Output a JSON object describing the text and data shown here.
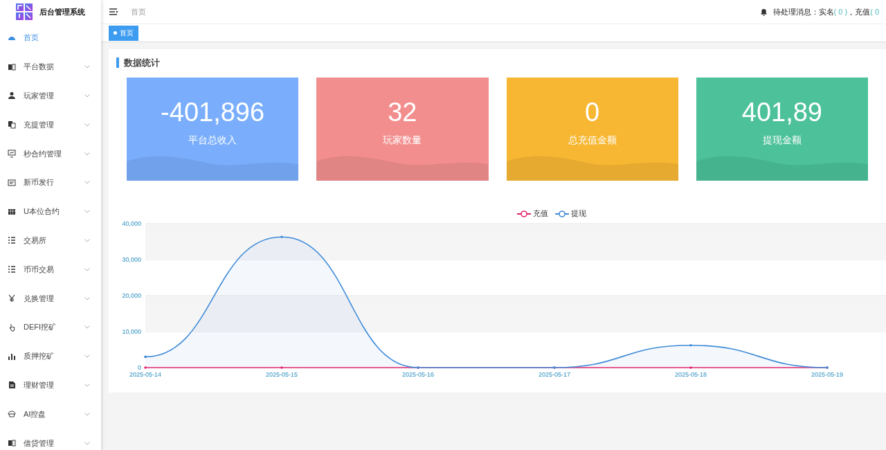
{
  "sidebar": {
    "title": "后台管理系统",
    "items": [
      {
        "label": "首页",
        "kind": "dashboard",
        "selected": true,
        "expandable": false
      },
      {
        "label": "平台数据",
        "kind": "book",
        "selected": false,
        "expandable": true
      },
      {
        "label": "玩家管理",
        "kind": "user",
        "selected": false,
        "expandable": true
      },
      {
        "label": "充提管理",
        "kind": "copy",
        "selected": false,
        "expandable": true
      },
      {
        "label": "秒合约管理",
        "kind": "monitor",
        "selected": false,
        "expandable": true
      },
      {
        "label": "新币发行",
        "kind": "card",
        "selected": false,
        "expandable": true
      },
      {
        "label": "U本位合约",
        "kind": "grid",
        "selected": false,
        "expandable": true
      },
      {
        "label": "交易所",
        "kind": "list",
        "selected": false,
        "expandable": true
      },
      {
        "label": "币币交易",
        "kind": "list",
        "selected": false,
        "expandable": true
      },
      {
        "label": "兑换管理",
        "kind": "yen",
        "selected": false,
        "expandable": true
      },
      {
        "label": "DEFI挖矿",
        "kind": "hand",
        "selected": false,
        "expandable": true
      },
      {
        "label": "质押挖矿",
        "kind": "bars",
        "selected": false,
        "expandable": true
      },
      {
        "label": "理财管理",
        "kind": "file",
        "selected": false,
        "expandable": true
      },
      {
        "label": "AI控盘",
        "kind": "robot",
        "selected": false,
        "expandable": true
      },
      {
        "label": "借贷管理",
        "kind": "book",
        "selected": false,
        "expandable": true
      }
    ]
  },
  "header": {
    "breadcrumb": "首页",
    "notice_label": "待处理消息：",
    "notices": [
      {
        "label": "实名",
        "count": "( 0 )",
        "separator": "，"
      },
      {
        "label": "充值",
        "count": "( 0"
      }
    ]
  },
  "tags": [
    {
      "label": "首页",
      "selected": true
    }
  ],
  "section_title": "数据统计",
  "stats": [
    {
      "value": "-401,896",
      "label": "平台总收入",
      "color": "#7aaefc"
    },
    {
      "value": "32",
      "label": "玩家数量",
      "color": "#f38e8e"
    },
    {
      "value": "0",
      "label": "总充值金额",
      "color": "#f7b733"
    },
    {
      "value": "401,89",
      "label": "提现金额",
      "color": "#4cc19a"
    }
  ],
  "chart_data": {
    "type": "line",
    "grid": true,
    "legend": true,
    "categories": [
      "2025-05-14",
      "2025-05-15",
      "2025-05-16",
      "2025-05-17",
      "2025-05-18",
      "2025-05-19"
    ],
    "series": [
      {
        "name": "充值",
        "color": "#e0246c",
        "values": [
          0,
          0,
          0,
          0,
          0,
          0
        ]
      },
      {
        "name": "提现",
        "color": "#3f8bd8",
        "values": [
          3000,
          36300,
          0,
          0,
          6200,
          0
        ]
      }
    ],
    "ylim": [
      0,
      40000
    ],
    "yticks": [
      {
        "value": 0,
        "label": "0"
      },
      {
        "value": 10000,
        "label": "10,000"
      },
      {
        "value": 20000,
        "label": "20,000"
      },
      {
        "value": 30000,
        "label": "30,000"
      },
      {
        "value": 40000,
        "label": "40,000"
      }
    ]
  }
}
